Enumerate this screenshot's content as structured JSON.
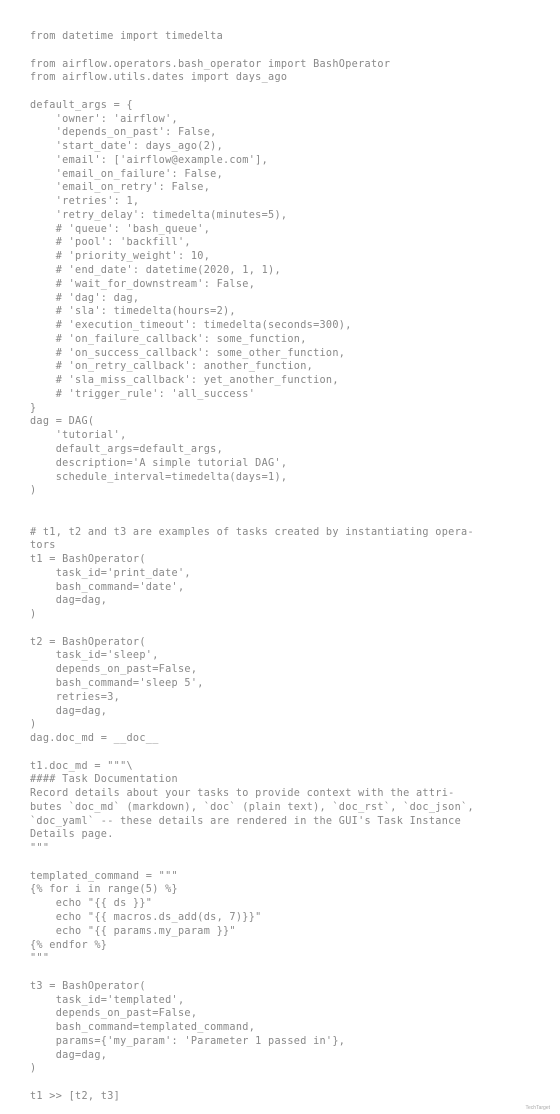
{
  "code": "from datetime import timedelta\n\nfrom airflow.operators.bash_operator import BashOperator\nfrom airflow.utils.dates import days_ago\n\ndefault_args = {\n    'owner': 'airflow',\n    'depends_on_past': False,\n    'start_date': days_ago(2),\n    'email': ['airflow@example.com'],\n    'email_on_failure': False,\n    'email_on_retry': False,\n    'retries': 1,\n    'retry_delay': timedelta(minutes=5),\n    # 'queue': 'bash_queue',\n    # 'pool': 'backfill',\n    # 'priority_weight': 10,\n    # 'end_date': datetime(2020, 1, 1),\n    # 'wait_for_downstream': False,\n    # 'dag': dag,\n    # 'sla': timedelta(hours=2),\n    # 'execution_timeout': timedelta(seconds=300),\n    # 'on_failure_callback': some_function,\n    # 'on_success_callback': some_other_function,\n    # 'on_retry_callback': another_function,\n    # 'sla_miss_callback': yet_another_function,\n    # 'trigger_rule': 'all_success'\n}\ndag = DAG(\n    'tutorial',\n    default_args=default_args,\n    description='A simple tutorial DAG',\n    schedule_interval=timedelta(days=1),\n)\n\n\n# t1, t2 and t3 are examples of tasks created by instantiating opera-\ntors\nt1 = BashOperator(\n    task_id='print_date',\n    bash_command='date',\n    dag=dag,\n)\n\nt2 = BashOperator(\n    task_id='sleep',\n    depends_on_past=False,\n    bash_command='sleep 5',\n    retries=3,\n    dag=dag,\n)\ndag.doc_md = __doc__\n\nt1.doc_md = \"\"\"\\\n#### Task Documentation\nRecord details about your tasks to provide context with the attri-\nbutes `doc_md` (markdown), `doc` (plain text), `doc_rst`, `doc_json`,\n`doc_yaml` -- these details are rendered in the GUI's Task Instance\nDetails page.\n\"\"\"\n\ntemplated_command = \"\"\"\n{% for i in range(5) %}\n    echo \"{{ ds }}\"\n    echo \"{{ macros.ds_add(ds, 7)}}\"\n    echo \"{{ params.my_param }}\"\n{% endfor %}\n\"\"\"\n\nt3 = BashOperator(\n    task_id='templated',\n    depends_on_past=False,\n    bash_command=templated_command,\n    params={'my_param': 'Parameter 1 passed in'},\n    dag=dag,\n)\n\nt1 >> [t2, t3]",
  "footer": "TechTarget"
}
